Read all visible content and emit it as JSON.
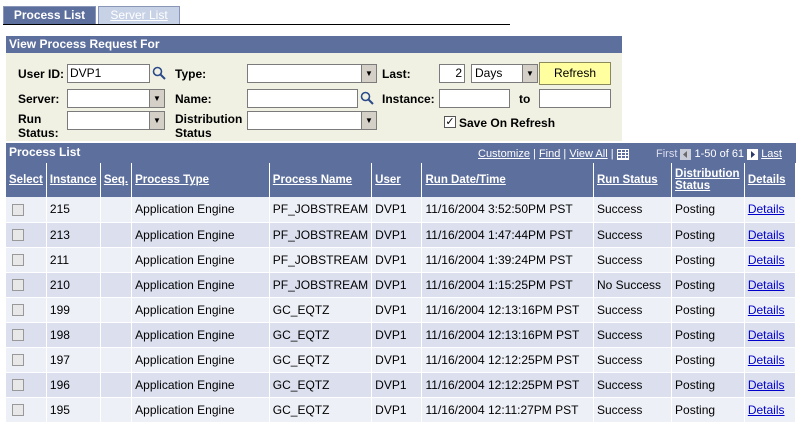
{
  "tabs": [
    {
      "label": "Process List",
      "active": true
    },
    {
      "label": "Server List",
      "active": false
    }
  ],
  "filter": {
    "header": "View Process Request For",
    "user_id_label": "User ID:",
    "user_id_value": "DVP1",
    "type_label": "Type:",
    "type_value": "",
    "last_label": "Last:",
    "last_value": "2",
    "last_unit": "Days",
    "refresh_label": "Refresh",
    "server_label": "Server:",
    "server_value": "",
    "name_label": "Name:",
    "name_value": "",
    "instance_label": "Instance:",
    "instance_from": "",
    "to_label": "to",
    "instance_to": "",
    "run_status_label_1": "Run",
    "run_status_label_2": "Status:",
    "run_status_value": "",
    "dist_status_label_1": "Distribution",
    "dist_status_label_2": "Status",
    "dist_status_value": "",
    "save_on_refresh_label": "Save On Refresh",
    "save_on_refresh_checked": true
  },
  "grid": {
    "title": "Process List",
    "nav": {
      "customize": "Customize",
      "sep1": "|",
      "find": "Find",
      "sep2": "|",
      "view_all": "View All",
      "sep3": "|",
      "first": "First",
      "range": "1-50 of 61",
      "last": "Last"
    },
    "columns": {
      "select": "Select",
      "instance": "Instance",
      "seq": "Seq.",
      "process_type": "Process Type",
      "process_name": "Process Name",
      "user": "User",
      "run_datetime": "Run Date/Time",
      "run_status": "Run Status",
      "dist_status_1": "Distribution",
      "dist_status_2": "Status",
      "details": "Details"
    },
    "rows": [
      {
        "instance": "215",
        "seq": "",
        "process_type": "Application Engine",
        "process_name": "PF_JOBSTREAM",
        "user": "DVP1",
        "run_datetime": "11/16/2004  3:52:50PM PST",
        "run_status": "Success",
        "dist_status": "Posting",
        "details": "Details"
      },
      {
        "instance": "213",
        "seq": "",
        "process_type": "Application Engine",
        "process_name": "PF_JOBSTREAM",
        "user": "DVP1",
        "run_datetime": "11/16/2004  1:47:44PM PST",
        "run_status": "Success",
        "dist_status": "Posting",
        "details": "Details"
      },
      {
        "instance": "211",
        "seq": "",
        "process_type": "Application Engine",
        "process_name": "PF_JOBSTREAM",
        "user": "DVP1",
        "run_datetime": "11/16/2004  1:39:24PM PST",
        "run_status": "Success",
        "dist_status": "Posting",
        "details": "Details"
      },
      {
        "instance": "210",
        "seq": "",
        "process_type": "Application Engine",
        "process_name": "PF_JOBSTREAM",
        "user": "DVP1",
        "run_datetime": "11/16/2004  1:15:25PM PST",
        "run_status": "No Success",
        "dist_status": "Posting",
        "details": "Details"
      },
      {
        "instance": "199",
        "seq": "",
        "process_type": "Application Engine",
        "process_name": "GC_EQTZ",
        "user": "DVP1",
        "run_datetime": "11/16/2004 12:13:16PM PST",
        "run_status": "Success",
        "dist_status": "Posting",
        "details": "Details"
      },
      {
        "instance": "198",
        "seq": "",
        "process_type": "Application Engine",
        "process_name": "GC_EQTZ",
        "user": "DVP1",
        "run_datetime": "11/16/2004 12:13:16PM PST",
        "run_status": "Success",
        "dist_status": "Posting",
        "details": "Details"
      },
      {
        "instance": "197",
        "seq": "",
        "process_type": "Application Engine",
        "process_name": "GC_EQTZ",
        "user": "DVP1",
        "run_datetime": "11/16/2004 12:12:25PM PST",
        "run_status": "Success",
        "dist_status": "Posting",
        "details": "Details"
      },
      {
        "instance": "196",
        "seq": "",
        "process_type": "Application Engine",
        "process_name": "GC_EQTZ",
        "user": "DVP1",
        "run_datetime": "11/16/2004 12:12:25PM PST",
        "run_status": "Success",
        "dist_status": "Posting",
        "details": "Details"
      },
      {
        "instance": "195",
        "seq": "",
        "process_type": "Application Engine",
        "process_name": "GC_EQTZ",
        "user": "DVP1",
        "run_datetime": "11/16/2004 12:11:27PM PST",
        "run_status": "Success",
        "dist_status": "Posting",
        "details": "Details"
      }
    ]
  },
  "colors": {
    "header_bg": "#5d6f9c",
    "panel_bg": "#f0f1e2",
    "row_even": "#eef0f7",
    "row_odd": "#dce0ee",
    "refresh_bg": "#ffffa0",
    "link": "#0000cc"
  }
}
